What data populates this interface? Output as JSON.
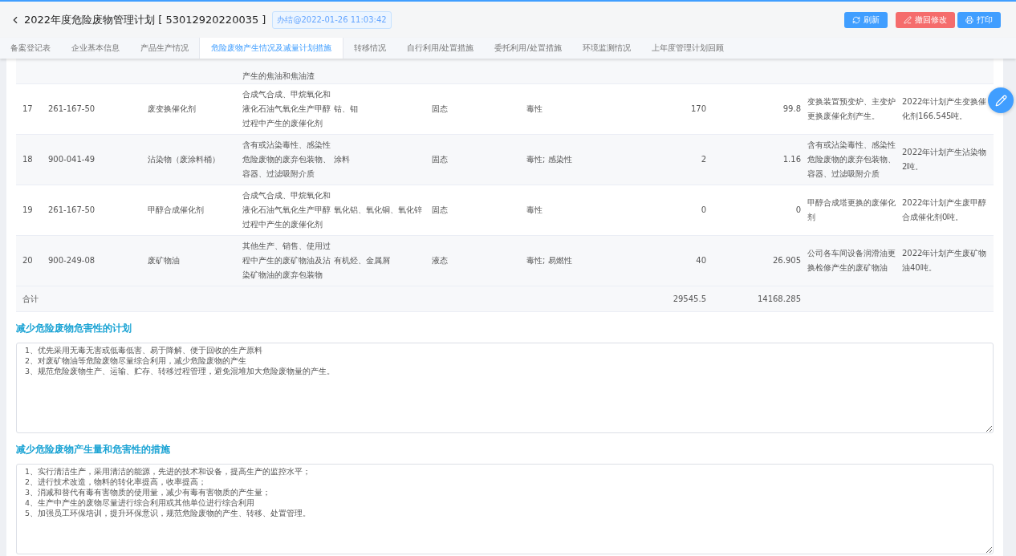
{
  "header": {
    "title": "2022年度危险废物管理计划 [ 53012920220035 ]",
    "status_badge": "办结@2022-01-26 11:03:42",
    "buttons": [
      {
        "kind": "refresh",
        "label": "刷新"
      },
      {
        "kind": "withdraw",
        "label": "撤回修改"
      },
      {
        "kind": "print",
        "label": "打印"
      }
    ]
  },
  "tabs": [
    {
      "label": "备案登记表",
      "selected": false
    },
    {
      "label": "企业基本信息",
      "selected": false
    },
    {
      "label": "产品生产情况",
      "selected": false
    },
    {
      "label": "危险废物产生情况及减量计划措施",
      "selected": true
    },
    {
      "label": "转移情况",
      "selected": false
    },
    {
      "label": "自行利用/处置措施",
      "selected": false
    },
    {
      "label": "委托利用/处置措施",
      "selected": false
    },
    {
      "label": "环境监测情况",
      "selected": false
    },
    {
      "label": "上年度管理计划回顾",
      "selected": false
    }
  ],
  "table": {
    "partial_row": {
      "column_4": "产生的焦油和焦油渣"
    },
    "rows": [
      {
        "cells": [
          "17",
          "261-167-50",
          "废变换催化剂",
          "合成气合成、甲烷氧化和液化石油气氧化生产甲醇过程中产生的废催化剂",
          "钴、钼",
          "固态",
          "毒性",
          "170",
          "99.8",
          "变换装置预变炉、主变炉更换废催化剂产生。",
          "2022年计划产生变换催化剂166.545吨。"
        ]
      },
      {
        "cells": [
          "18",
          "900-041-49",
          "沾染物（废涂料桶）",
          "含有或沾染毒性、感染性危险废物的废弃包装物、容器、过滤吸附介质",
          "涂料",
          "固态",
          "毒性; 感染性",
          "2",
          "1.16",
          "含有或沾染毒性、感染性危险废物的废弃包装物、容器、过滤吸附介质",
          "2022年计划产生沾染物2吨。"
        ]
      },
      {
        "cells": [
          "19",
          "261-167-50",
          "甲醇合成催化剂",
          "合成气合成、甲烷氧化和液化石油气氧化生产甲醇过程中产生的废催化剂",
          "氧化铝、氧化铜、氧化锌",
          "固态",
          "毒性",
          "0",
          "0",
          "甲醇合成塔更换的废催化剂",
          "2022年计划产生废甲醇合成催化剂0吨。"
        ]
      },
      {
        "cells": [
          "20",
          "900-249-08",
          "废矿物油",
          "其他生产、销售、使用过程中产生的废矿物油及沾染矿物油的废弃包装物",
          "有机烃、金属屑",
          "液态",
          "毒性; 易燃性",
          "40",
          "26.905",
          "公司各车间设备润滑油更换检修产生的废矿物油",
          "2022年计划产生废矿物油40吨。"
        ]
      }
    ],
    "total": {
      "label": "合计",
      "column_8": "29545.5",
      "column_9": "14168.285"
    }
  },
  "sections": [
    {
      "heading": "减少危险废物危害性的计划",
      "text": "1、优先采用无毒无害或低毒低害、易于降解、便于回收的生产原料\n2、对废矿物油等危险废物尽量综合利用，减少危险废物的产生\n3、规范危险废物生产、运输、贮存、转移过程管理，避免混堆加大危险废物量的产生。"
    },
    {
      "heading": "减少危险废物产生量和危害性的措施",
      "text": "1、实行清洁生产，采用清洁的能源，先进的技术和设备，提高生产的监控水平；\n2、进行技术改造，物料的转化率提高，收率提高；\n3、消减和替代有毒有害物质的使用量，减少有毒有害物质的产生量；\n4、生产中产生的废物尽量进行综合利用或其他单位进行综合利用\n5、加强员工环保培训，提升环保意识，规范危险废物的产生、转移、处置管理。"
    }
  ]
}
